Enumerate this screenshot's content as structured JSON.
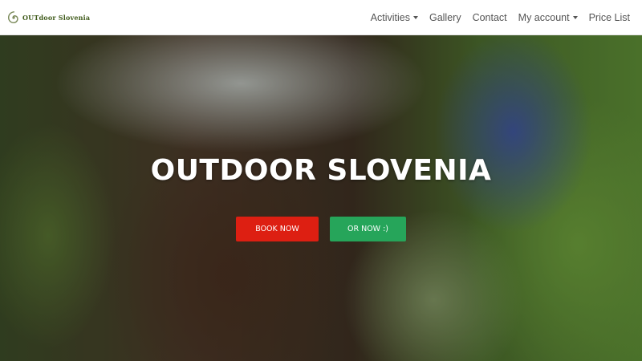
{
  "brand": {
    "logo_text": "OUTdoor Slovenia"
  },
  "nav": {
    "items": [
      {
        "label": "Activities",
        "dropdown": true
      },
      {
        "label": "Gallery",
        "dropdown": false
      },
      {
        "label": "Contact",
        "dropdown": false
      },
      {
        "label": "My account",
        "dropdown": true
      },
      {
        "label": "Price List",
        "dropdown": false
      }
    ]
  },
  "hero": {
    "title": "OUTDOOR SLOVENIA",
    "primary_button": "BOOK NOW",
    "secondary_button": "OR NOW :)"
  },
  "colors": {
    "book_button": "#dd1f12",
    "or_now_button": "#26a55a",
    "logo_green": "#3f5a1a"
  },
  "icons": [
    "spiral-logo-icon",
    "caret-down-icon"
  ]
}
